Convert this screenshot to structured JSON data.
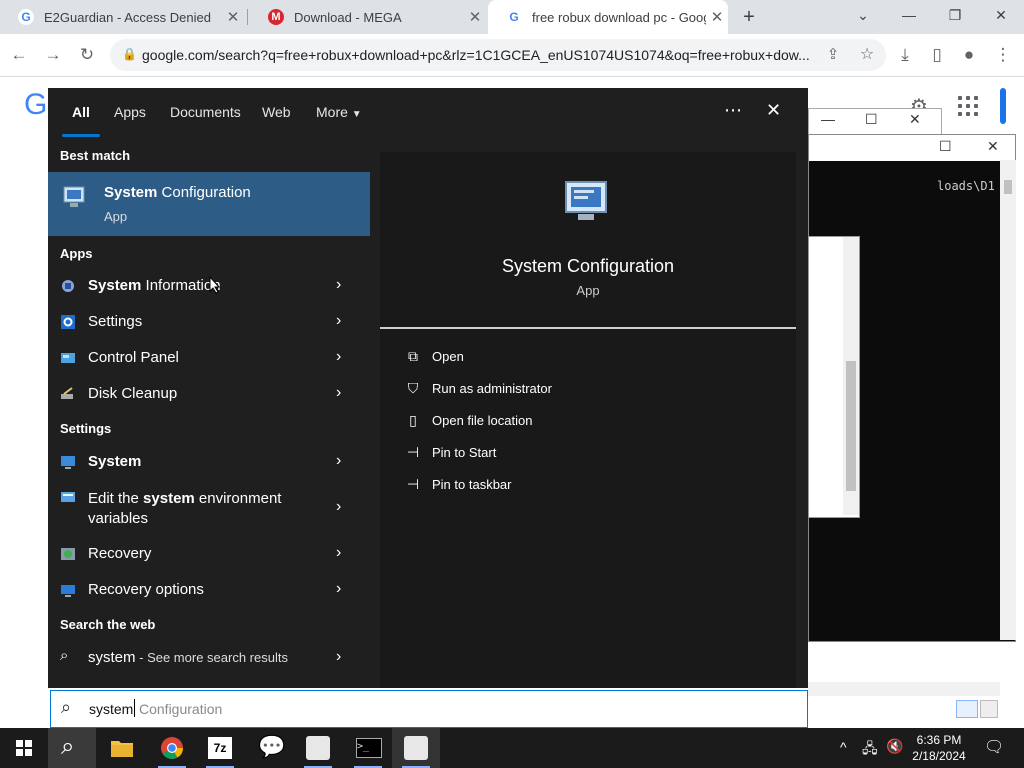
{
  "browser": {
    "tabs": [
      {
        "title": "E2Guardian - Access Denied",
        "icon": "google-favicon"
      },
      {
        "title": "Download - MEGA",
        "icon": "mega-favicon"
      },
      {
        "title": "free robux download pc - Google",
        "icon": "google-favicon"
      }
    ],
    "url": "google.com/search?q=free+robux+download+pc&rlz=1C1GCEA_enUS1074US1074&oq=free+robux+dow..."
  },
  "cmd": {
    "visible_text": "loads\\D1"
  },
  "search_panel": {
    "tabs": [
      "All",
      "Apps",
      "Documents",
      "Web",
      "More"
    ],
    "best_match": {
      "header": "Best match",
      "title_bold": "System",
      "title_rest": " Configuration",
      "subtitle": "App"
    },
    "apps_header": "Apps",
    "apps": [
      {
        "bold": "System",
        "rest": " Information",
        "icon": "system-information-icon"
      },
      {
        "bold": "",
        "rest": "Settings",
        "icon": "settings-icon"
      },
      {
        "bold": "",
        "rest": "Control Panel",
        "icon": "control-panel-icon"
      },
      {
        "bold": "",
        "rest": "Disk Cleanup",
        "icon": "disk-cleanup-icon"
      }
    ],
    "settings_header": "Settings",
    "settings": [
      {
        "pre": "",
        "bold": "System",
        "post": "",
        "line2": "",
        "icon": "system-icon"
      },
      {
        "pre": "Edit the ",
        "bold": "system",
        "post": " environment",
        "line2": "variables",
        "icon": "environment-variables-icon"
      },
      {
        "pre": "Recovery",
        "bold": "",
        "post": "",
        "line2": "",
        "icon": "recovery-icon"
      },
      {
        "pre": "Recovery options",
        "bold": "",
        "post": "",
        "line2": "",
        "icon": "recovery-options-icon"
      }
    ],
    "web_header": "Search the web",
    "web": {
      "query": "system",
      "suffix": " - See more search results"
    },
    "detail": {
      "title": "System Configuration",
      "subtitle": "App",
      "actions": [
        {
          "label": "Open",
          "icon": "open-icon"
        },
        {
          "label": "Run as administrator",
          "icon": "shield-icon"
        },
        {
          "label": "Open file location",
          "icon": "file-location-icon"
        },
        {
          "label": "Pin to Start",
          "icon": "pin-icon"
        },
        {
          "label": "Pin to taskbar",
          "icon": "pin-icon"
        }
      ]
    },
    "search_box": {
      "typed": "system",
      "completion": "Configuration"
    }
  },
  "taskbar": {
    "time": "6:36 PM",
    "date": "2/18/2024"
  },
  "colors": {
    "panel_bg": "#1f1f1f",
    "selection": "#2d5c86",
    "accent": "#0078d4"
  }
}
